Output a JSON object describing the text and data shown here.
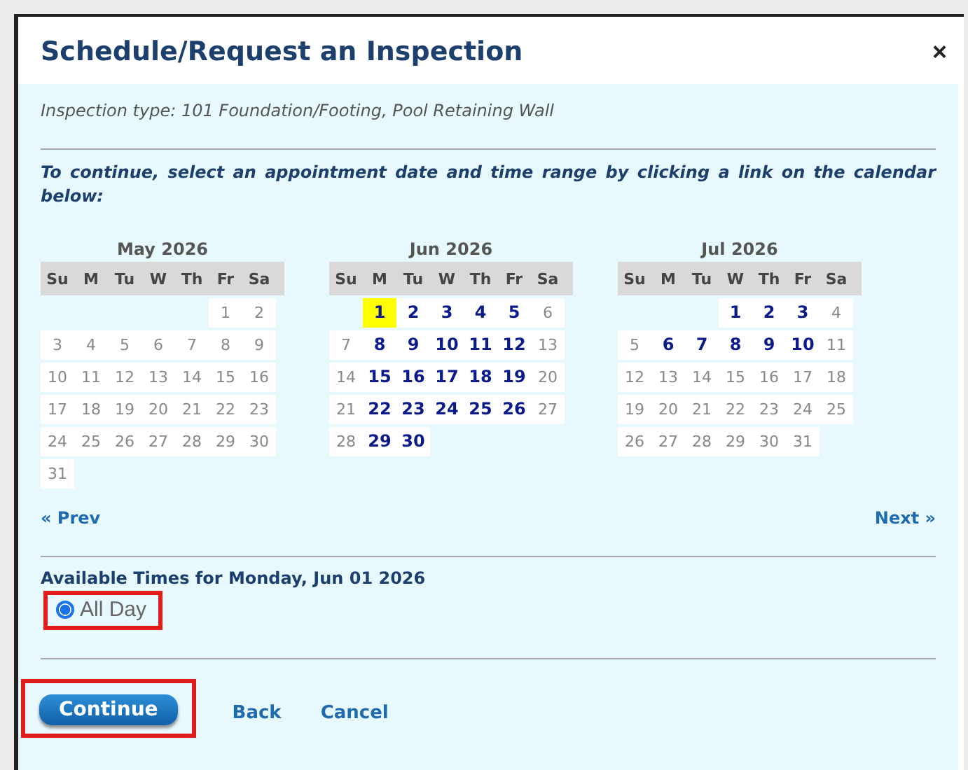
{
  "dialog": {
    "title": "Schedule/Request an Inspection",
    "close": "×"
  },
  "inspection_type": "Inspection type: 101 Foundation/Footing, Pool Retaining Wall",
  "instruction": "To continue, select an appointment date and time range by clicking a link on the calendar below:",
  "months": [
    {
      "title": "May 2026",
      "weekdays": [
        "Su",
        "M",
        "Tu",
        "W",
        "Th",
        "Fr",
        "Sa"
      ],
      "weeks": [
        [
          {
            "kind": "blank"
          },
          {
            "kind": "blank"
          },
          {
            "kind": "blank"
          },
          {
            "kind": "blank"
          },
          {
            "kind": "blank"
          },
          {
            "kind": "day",
            "day": "1",
            "available": false,
            "selected": false
          },
          {
            "kind": "day",
            "day": "2",
            "available": false,
            "selected": false
          }
        ],
        [
          {
            "kind": "day",
            "day": "3",
            "available": false,
            "selected": false
          },
          {
            "kind": "day",
            "day": "4",
            "available": false,
            "selected": false
          },
          {
            "kind": "day",
            "day": "5",
            "available": false,
            "selected": false
          },
          {
            "kind": "day",
            "day": "6",
            "available": false,
            "selected": false
          },
          {
            "kind": "day",
            "day": "7",
            "available": false,
            "selected": false
          },
          {
            "kind": "day",
            "day": "8",
            "available": false,
            "selected": false
          },
          {
            "kind": "day",
            "day": "9",
            "available": false,
            "selected": false
          }
        ],
        [
          {
            "kind": "day",
            "day": "10",
            "available": false,
            "selected": false
          },
          {
            "kind": "day",
            "day": "11",
            "available": false,
            "selected": false
          },
          {
            "kind": "day",
            "day": "12",
            "available": false,
            "selected": false
          },
          {
            "kind": "day",
            "day": "13",
            "available": false,
            "selected": false
          },
          {
            "kind": "day",
            "day": "14",
            "available": false,
            "selected": false
          },
          {
            "kind": "day",
            "day": "15",
            "available": false,
            "selected": false
          },
          {
            "kind": "day",
            "day": "16",
            "available": false,
            "selected": false
          }
        ],
        [
          {
            "kind": "day",
            "day": "17",
            "available": false,
            "selected": false
          },
          {
            "kind": "day",
            "day": "18",
            "available": false,
            "selected": false
          },
          {
            "kind": "day",
            "day": "19",
            "available": false,
            "selected": false
          },
          {
            "kind": "day",
            "day": "20",
            "available": false,
            "selected": false
          },
          {
            "kind": "day",
            "day": "21",
            "available": false,
            "selected": false
          },
          {
            "kind": "day",
            "day": "22",
            "available": false,
            "selected": false
          },
          {
            "kind": "day",
            "day": "23",
            "available": false,
            "selected": false
          }
        ],
        [
          {
            "kind": "day",
            "day": "24",
            "available": false,
            "selected": false
          },
          {
            "kind": "day",
            "day": "25",
            "available": false,
            "selected": false
          },
          {
            "kind": "day",
            "day": "26",
            "available": false,
            "selected": false
          },
          {
            "kind": "day",
            "day": "27",
            "available": false,
            "selected": false
          },
          {
            "kind": "day",
            "day": "28",
            "available": false,
            "selected": false
          },
          {
            "kind": "day",
            "day": "29",
            "available": false,
            "selected": false
          },
          {
            "kind": "day",
            "day": "30",
            "available": false,
            "selected": false
          }
        ],
        [
          {
            "kind": "day",
            "day": "31",
            "available": false,
            "selected": false
          }
        ]
      ]
    },
    {
      "title": "Jun 2026",
      "weekdays": [
        "Su",
        "M",
        "Tu",
        "W",
        "Th",
        "Fr",
        "Sa"
      ],
      "weeks": [
        [
          {
            "kind": "blank"
          },
          {
            "kind": "day",
            "day": "1",
            "available": true,
            "selected": true
          },
          {
            "kind": "day",
            "day": "2",
            "available": true,
            "selected": false
          },
          {
            "kind": "day",
            "day": "3",
            "available": true,
            "selected": false
          },
          {
            "kind": "day",
            "day": "4",
            "available": true,
            "selected": false
          },
          {
            "kind": "day",
            "day": "5",
            "available": true,
            "selected": false
          },
          {
            "kind": "day",
            "day": "6",
            "available": false,
            "selected": false
          }
        ],
        [
          {
            "kind": "day",
            "day": "7",
            "available": false,
            "selected": false
          },
          {
            "kind": "day",
            "day": "8",
            "available": true,
            "selected": false
          },
          {
            "kind": "day",
            "day": "9",
            "available": true,
            "selected": false
          },
          {
            "kind": "day",
            "day": "10",
            "available": true,
            "selected": false
          },
          {
            "kind": "day",
            "day": "11",
            "available": true,
            "selected": false
          },
          {
            "kind": "day",
            "day": "12",
            "available": true,
            "selected": false
          },
          {
            "kind": "day",
            "day": "13",
            "available": false,
            "selected": false
          }
        ],
        [
          {
            "kind": "day",
            "day": "14",
            "available": false,
            "selected": false
          },
          {
            "kind": "day",
            "day": "15",
            "available": true,
            "selected": false
          },
          {
            "kind": "day",
            "day": "16",
            "available": true,
            "selected": false
          },
          {
            "kind": "day",
            "day": "17",
            "available": true,
            "selected": false
          },
          {
            "kind": "day",
            "day": "18",
            "available": true,
            "selected": false
          },
          {
            "kind": "day",
            "day": "19",
            "available": true,
            "selected": false
          },
          {
            "kind": "day",
            "day": "20",
            "available": false,
            "selected": false
          }
        ],
        [
          {
            "kind": "day",
            "day": "21",
            "available": false,
            "selected": false
          },
          {
            "kind": "day",
            "day": "22",
            "available": true,
            "selected": false
          },
          {
            "kind": "day",
            "day": "23",
            "available": true,
            "selected": false
          },
          {
            "kind": "day",
            "day": "24",
            "available": true,
            "selected": false
          },
          {
            "kind": "day",
            "day": "25",
            "available": true,
            "selected": false
          },
          {
            "kind": "day",
            "day": "26",
            "available": true,
            "selected": false
          },
          {
            "kind": "day",
            "day": "27",
            "available": false,
            "selected": false
          }
        ],
        [
          {
            "kind": "day",
            "day": "28",
            "available": false,
            "selected": false
          },
          {
            "kind": "day",
            "day": "29",
            "available": true,
            "selected": false
          },
          {
            "kind": "day",
            "day": "30",
            "available": true,
            "selected": false
          }
        ]
      ]
    },
    {
      "title": "Jul 2026",
      "weekdays": [
        "Su",
        "M",
        "Tu",
        "W",
        "Th",
        "Fr",
        "Sa"
      ],
      "weeks": [
        [
          {
            "kind": "blank"
          },
          {
            "kind": "blank"
          },
          {
            "kind": "blank"
          },
          {
            "kind": "day",
            "day": "1",
            "available": true,
            "selected": false
          },
          {
            "kind": "day",
            "day": "2",
            "available": true,
            "selected": false
          },
          {
            "kind": "day",
            "day": "3",
            "available": true,
            "selected": false
          },
          {
            "kind": "day",
            "day": "4",
            "available": false,
            "selected": false
          }
        ],
        [
          {
            "kind": "day",
            "day": "5",
            "available": false,
            "selected": false
          },
          {
            "kind": "day",
            "day": "6",
            "available": true,
            "selected": false
          },
          {
            "kind": "day",
            "day": "7",
            "available": true,
            "selected": false
          },
          {
            "kind": "day",
            "day": "8",
            "available": true,
            "selected": false
          },
          {
            "kind": "day",
            "day": "9",
            "available": true,
            "selected": false
          },
          {
            "kind": "day",
            "day": "10",
            "available": true,
            "selected": false
          },
          {
            "kind": "day",
            "day": "11",
            "available": false,
            "selected": false
          }
        ],
        [
          {
            "kind": "day",
            "day": "12",
            "available": false,
            "selected": false
          },
          {
            "kind": "day",
            "day": "13",
            "available": false,
            "selected": false
          },
          {
            "kind": "day",
            "day": "14",
            "available": false,
            "selected": false
          },
          {
            "kind": "day",
            "day": "15",
            "available": false,
            "selected": false
          },
          {
            "kind": "day",
            "day": "16",
            "available": false,
            "selected": false
          },
          {
            "kind": "day",
            "day": "17",
            "available": false,
            "selected": false
          },
          {
            "kind": "day",
            "day": "18",
            "available": false,
            "selected": false
          }
        ],
        [
          {
            "kind": "day",
            "day": "19",
            "available": false,
            "selected": false
          },
          {
            "kind": "day",
            "day": "20",
            "available": false,
            "selected": false
          },
          {
            "kind": "day",
            "day": "21",
            "available": false,
            "selected": false
          },
          {
            "kind": "day",
            "day": "22",
            "available": false,
            "selected": false
          },
          {
            "kind": "day",
            "day": "23",
            "available": false,
            "selected": false
          },
          {
            "kind": "day",
            "day": "24",
            "available": false,
            "selected": false
          },
          {
            "kind": "day",
            "day": "25",
            "available": false,
            "selected": false
          }
        ],
        [
          {
            "kind": "day",
            "day": "26",
            "available": false,
            "selected": false
          },
          {
            "kind": "day",
            "day": "27",
            "available": false,
            "selected": false
          },
          {
            "kind": "day",
            "day": "28",
            "available": false,
            "selected": false
          },
          {
            "kind": "day",
            "day": "29",
            "available": false,
            "selected": false
          },
          {
            "kind": "day",
            "day": "30",
            "available": false,
            "selected": false
          },
          {
            "kind": "day",
            "day": "31",
            "available": false,
            "selected": false
          }
        ]
      ]
    }
  ],
  "prev": "« Prev",
  "next": "Next »",
  "times_heading": "Available Times for Monday, Jun 01 2026",
  "time_options": [
    {
      "label": "All Day",
      "selected": true,
      "highlighted": true
    }
  ],
  "buttons": [
    {
      "kind": "primary",
      "label": "Continue",
      "highlighted": true
    },
    {
      "kind": "link",
      "label": "Back",
      "highlighted": false
    },
    {
      "kind": "link",
      "label": "Cancel",
      "highlighted": false
    }
  ]
}
